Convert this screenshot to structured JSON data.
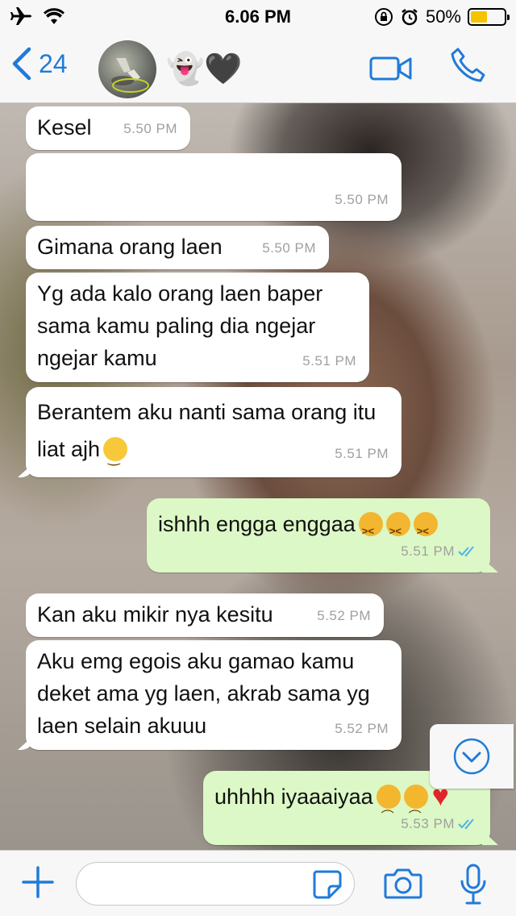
{
  "status_bar": {
    "time": "6.06 PM",
    "battery": "50%",
    "battery_level": 0.5
  },
  "header": {
    "back_count": "24",
    "contact_name": "👻🖤",
    "icons": [
      "back-chevron-icon",
      "video-call-icon",
      "phone-icon"
    ]
  },
  "messages": [
    {
      "id": "m1",
      "direction": "in",
      "text": "Kesel",
      "time": "5.50 PM"
    },
    {
      "id": "m2",
      "direction": "in",
      "text": "",
      "time": "5.50 PM",
      "redacted": true
    },
    {
      "id": "m3",
      "direction": "in",
      "text": "Gimana orang laen",
      "time": "5.50 PM"
    },
    {
      "id": "m4",
      "direction": "in",
      "text": "Yg ada kalo orang laen baper sama kamu paling dia ngejar ngejar kamu",
      "time": "5.51 PM"
    },
    {
      "id": "m5",
      "direction": "in",
      "text": "Berantem aku nanti sama orang itu liat ajh",
      "time": "5.51 PM",
      "emoji": [
        "slightly-smiling-face"
      ]
    },
    {
      "id": "m6",
      "direction": "out",
      "text": "ishhh engga enggaa",
      "time": "5.51 PM",
      "emoji": [
        "confounded-face",
        "confounded-face",
        "confounded-face"
      ],
      "read": true
    },
    {
      "id": "m7",
      "direction": "in",
      "text": "Kan aku mikir nya kesitu",
      "time": "5.52 PM"
    },
    {
      "id": "m8",
      "direction": "in",
      "text": "Aku emg egois aku gamao kamu deket ama yg laen, akrab sama yg laen selain akuuu",
      "time": "5.52 PM"
    },
    {
      "id": "m9",
      "direction": "out",
      "text": "uhhhh iyaaaiyaa",
      "time": "5.53 PM",
      "emoji": [
        "frowning-face",
        "frowning-face",
        "red-heart"
      ],
      "read": true
    }
  ],
  "input_bar": {
    "placeholder": "",
    "icons": [
      "plus-icon",
      "sticker-icon",
      "camera-icon",
      "microphone-icon"
    ]
  },
  "colors": {
    "accent": "#1f7bd9",
    "outgoing_bubble": "#dcf8c6",
    "incoming_bubble": "#ffffff",
    "read_ticks": "#4fb3e8",
    "battery_fill": "#f5c400"
  }
}
